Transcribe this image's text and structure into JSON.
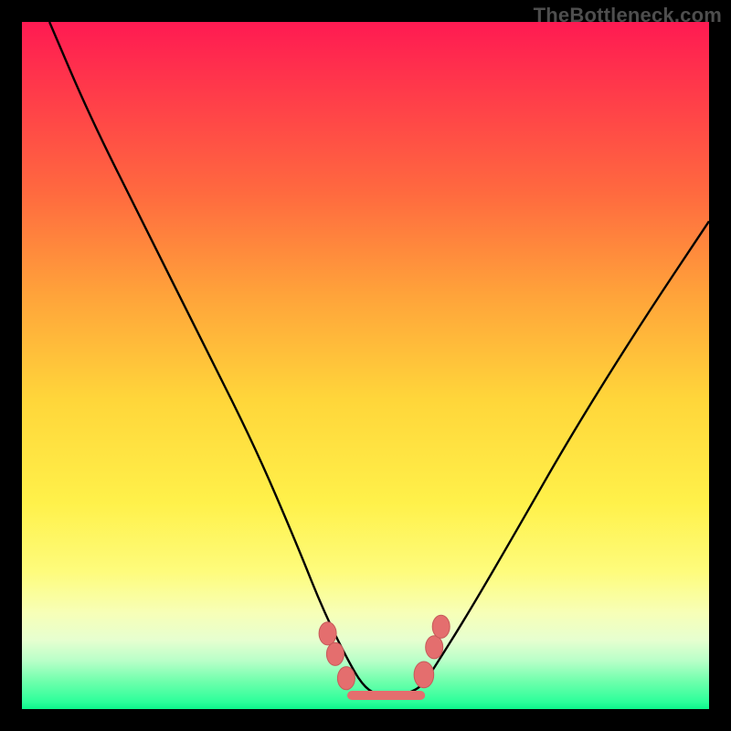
{
  "watermark": "TheBottleneck.com",
  "colors": {
    "frame": "#000000",
    "curve": "#000000",
    "marker_fill": "#e46e6e",
    "marker_stroke": "#c65a5a"
  },
  "chart_data": {
    "type": "line",
    "title": "",
    "xlabel": "",
    "ylabel": "",
    "xlim": [
      0,
      100
    ],
    "ylim": [
      0,
      100
    ],
    "axes_visible": false,
    "grid": false,
    "interpretation": "V-shaped bottleneck curve; lower y (toward green) indicates better match. Minimum around x≈50–55.",
    "series": [
      {
        "name": "bottleneck",
        "x": [
          4,
          10,
          18,
          26,
          34,
          40,
          44,
          48,
          50,
          52,
          55,
          58,
          60,
          65,
          72,
          80,
          90,
          100
        ],
        "y": [
          100,
          86,
          70,
          54,
          38,
          24,
          14,
          6,
          3,
          2,
          2,
          3,
          6,
          14,
          26,
          40,
          56,
          71
        ]
      }
    ],
    "flat_segment": {
      "comment": "Salmon-colored markers/segment near trough",
      "x_start": 48,
      "x_end": 58,
      "y": 2
    },
    "markers": [
      {
        "x": 44.5,
        "y": 11,
        "r": 1.4
      },
      {
        "x": 45.6,
        "y": 8,
        "r": 1.4
      },
      {
        "x": 47.2,
        "y": 4.5,
        "r": 1.4
      },
      {
        "x": 58.5,
        "y": 5,
        "r": 1.6
      },
      {
        "x": 60.0,
        "y": 9,
        "r": 1.4
      },
      {
        "x": 61.0,
        "y": 12,
        "r": 1.4
      }
    ]
  }
}
